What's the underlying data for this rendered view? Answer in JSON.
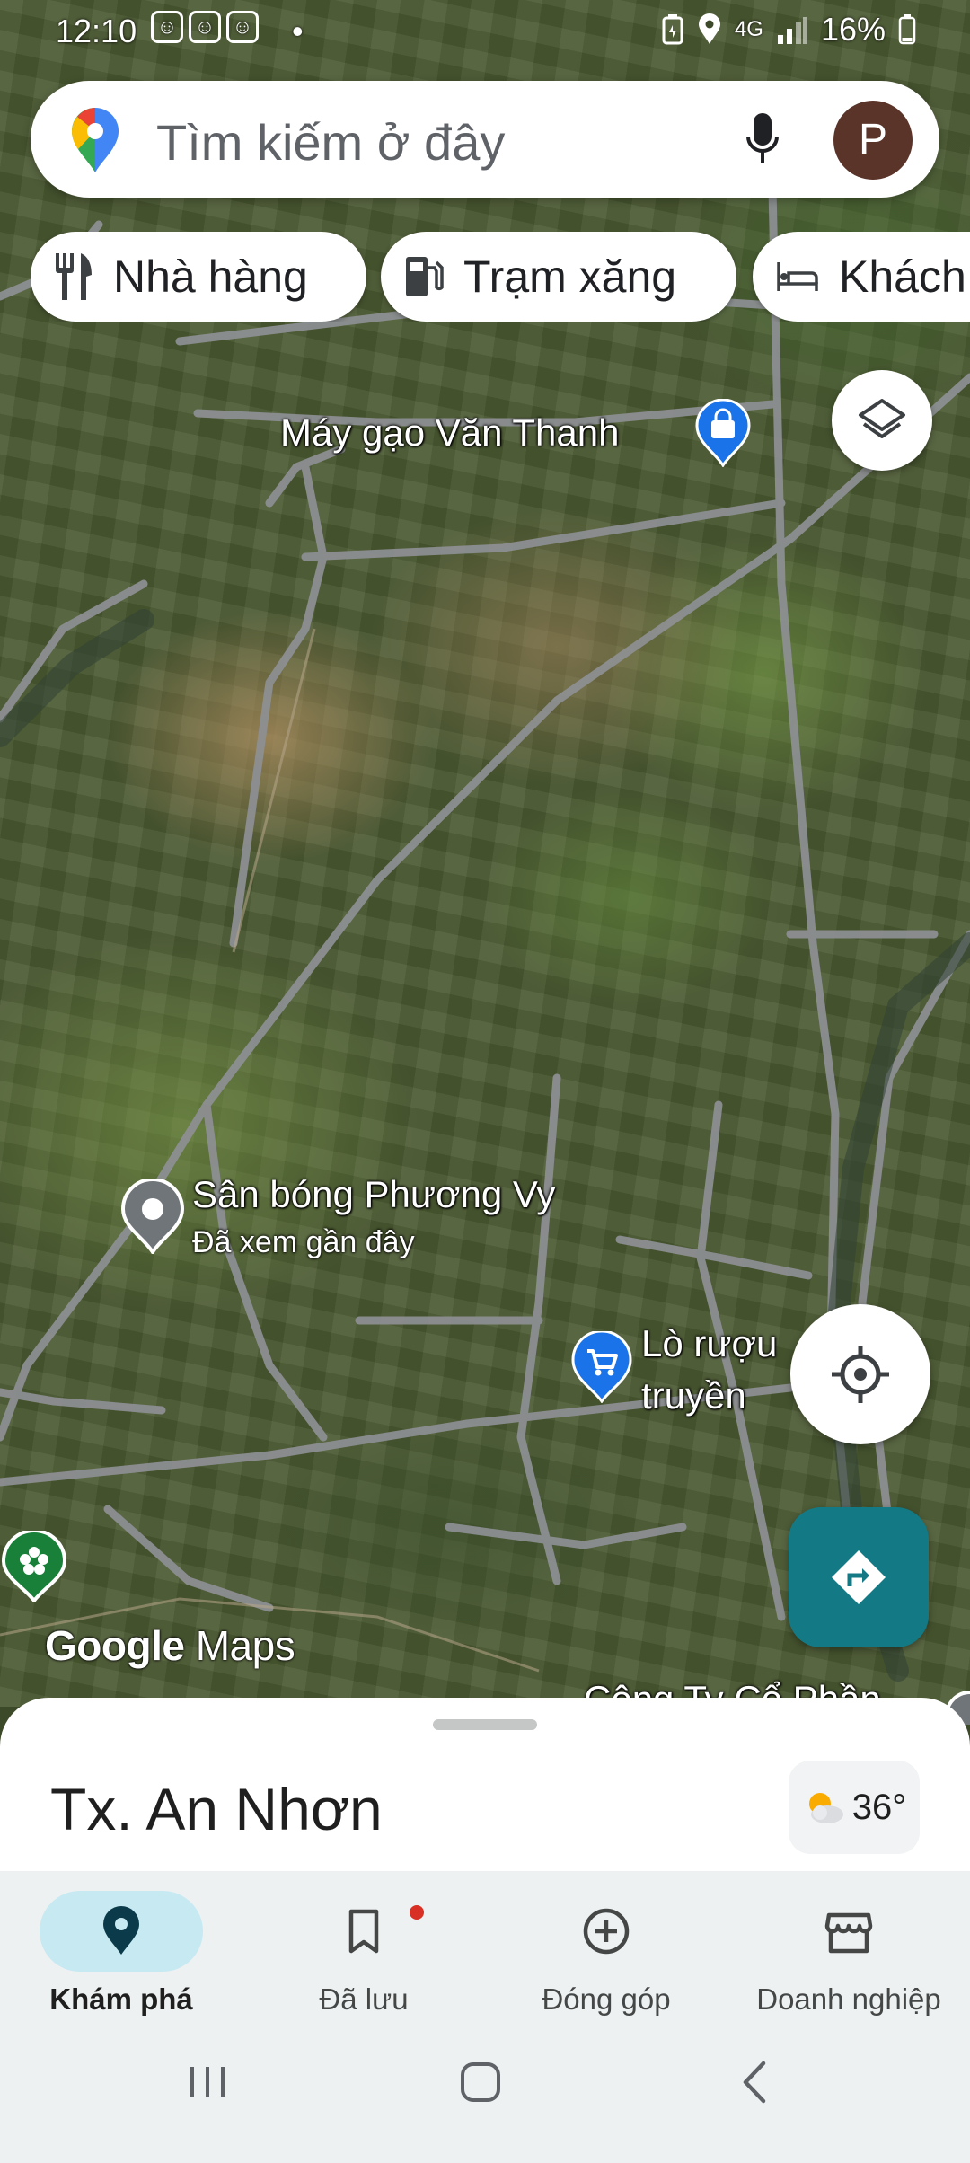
{
  "status_bar": {
    "time": "12:10",
    "dot": "•",
    "network": "4G",
    "battery": "16%"
  },
  "search": {
    "placeholder": "Tìm kiếm ở đây",
    "avatar_letter": "P"
  },
  "chips": [
    {
      "label": "Nhà hàng",
      "icon": "restaurant-icon"
    },
    {
      "label": "Trạm xăng",
      "icon": "gas-station-icon"
    },
    {
      "label": "Khách",
      "icon": "hotel-icon"
    }
  ],
  "map": {
    "labels": {
      "rice_mill": "Máy gạo Văn Thanh",
      "football_field": "Sân bóng Phương Vy",
      "football_field_note": "Đã xem gần đây",
      "winery_line1": "Lò rượu",
      "winery_line2": "truyền",
      "company_partial": "Công Ty Cổ Phần"
    },
    "watermark_google": "Google",
    "watermark_maps": "Maps"
  },
  "sheet": {
    "place_title": "Tx. An Nhơn",
    "weather_temp": "36°"
  },
  "nav": {
    "explore": "Khám phá",
    "saved": "Đã lưu",
    "contribute": "Đóng góp",
    "business": "Doanh nghiệp"
  },
  "colors": {
    "accent_teal": "#137a85",
    "active_pill": "#c6e9f2",
    "pin_blue": "#1a73e8",
    "pin_gray": "#70757a",
    "pin_green": "#188038"
  }
}
